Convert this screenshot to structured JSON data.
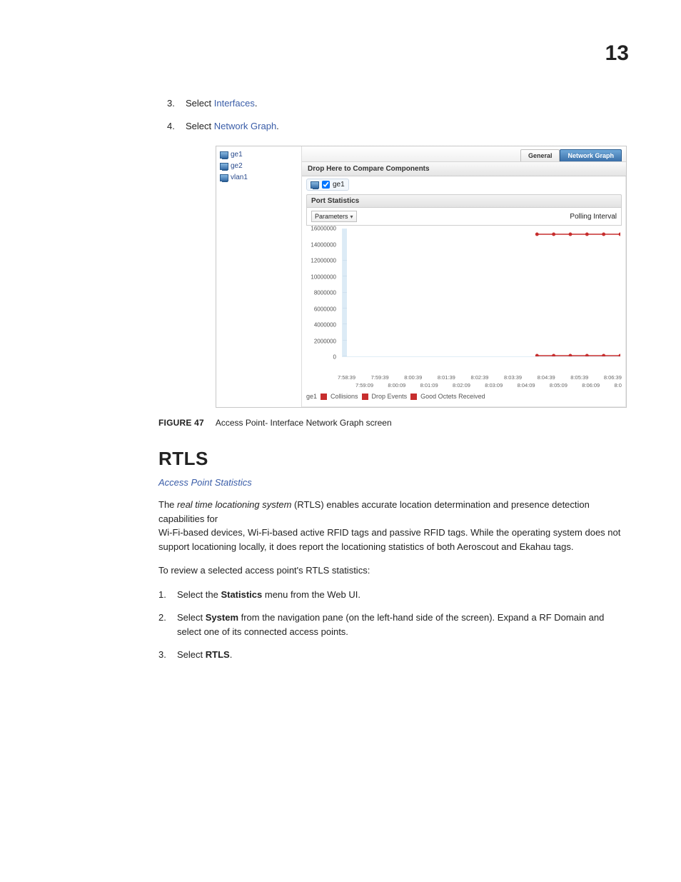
{
  "page_number": "13",
  "steps_top": [
    {
      "num": "3.",
      "prefix": "Select ",
      "link": "Interfaces",
      "suffix": "."
    },
    {
      "num": "4.",
      "prefix": "Select ",
      "link": "Network Graph",
      "suffix": "."
    }
  ],
  "screenshot": {
    "tree": [
      "ge1",
      "ge2",
      "vlan1"
    ],
    "tabs": {
      "inactive": "General",
      "active": "Network Graph"
    },
    "drop_text": "Drop Here to Compare Components",
    "selected_chip": "ge1",
    "panel_title": "Port Statistics",
    "parameters_label": "Parameters",
    "polling_label": "Polling Interval",
    "legend": {
      "series_ref": "ge1",
      "items": [
        {
          "color": "#c72e2e",
          "label": "Collisions"
        },
        {
          "color": "#c72e2e",
          "label": "Drop Events"
        },
        {
          "color": "#c72e2e",
          "label": "Good Octets Received"
        }
      ]
    }
  },
  "chart_data": {
    "type": "line",
    "title": "Port Statistics",
    "ylabel": "",
    "xlabel": "",
    "ylim": [
      0,
      16000000
    ],
    "y_ticks": [
      16000000,
      14000000,
      12000000,
      10000000,
      8000000,
      6000000,
      4000000,
      2000000,
      0
    ],
    "x_ticks_row1": [
      "7:58:39",
      "7:59:39",
      "8:00:39",
      "8:01:39",
      "8:02:39",
      "8:03:39",
      "8:04:39",
      "8:05:39",
      "8:06:39"
    ],
    "x_ticks_row2": [
      "7:59:09",
      "8:00:09",
      "8:01:09",
      "8:02:09",
      "8:03:09",
      "8:04:09",
      "8:05:09",
      "8:06:09",
      "8:0"
    ],
    "series": [
      {
        "name": "Collisions",
        "values": [
          null,
          null,
          null,
          null,
          null,
          null,
          null,
          null,
          null,
          null,
          null,
          null,
          0,
          0,
          0,
          0,
          0,
          0
        ]
      },
      {
        "name": "Drop Events",
        "values": [
          null,
          null,
          null,
          null,
          null,
          null,
          null,
          null,
          null,
          null,
          null,
          null,
          0,
          0,
          0,
          0,
          0,
          0
        ]
      },
      {
        "name": "Good Octets Received",
        "values": [
          null,
          null,
          null,
          null,
          null,
          null,
          null,
          null,
          null,
          null,
          null,
          null,
          15200000,
          15200000,
          15200000,
          15200000,
          15200000,
          15200000
        ]
      }
    ]
  },
  "figure": {
    "label": "FIGURE 47",
    "caption": "Access Point- Interface Network Graph screen"
  },
  "section_heading": "RTLS",
  "breadcrumb": "Access Point Statistics",
  "para1_a": "The ",
  "para1_ital": "real time locationing system",
  "para1_b": " (RTLS) enables accurate location determination and presence detection capabilities for",
  "para1_c": "Wi-Fi-based devices, Wi-Fi-based active RFID tags and passive RFID tags. While the operating system does not support locationing locally, it does report the locationing statistics of both Aeroscout and Ekahau tags.",
  "para2": "To review a selected access point's RTLS statistics:",
  "steps_bottom": [
    {
      "num": "1.",
      "text_a": "Select the ",
      "bold": "Statistics",
      "text_b": " menu from the Web UI."
    },
    {
      "num": "2.",
      "text_a": "Select ",
      "bold": "System",
      "text_b": " from the navigation pane (on the left-hand side of the screen). Expand a RF Domain and select one of its connected access points."
    },
    {
      "num": "3.",
      "text_a": "Select ",
      "bold": "RTLS",
      "text_b": "."
    }
  ]
}
